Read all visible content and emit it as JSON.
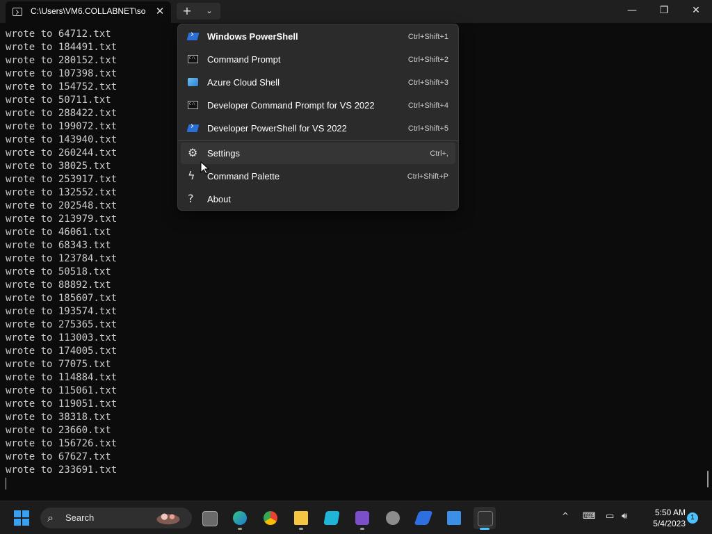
{
  "titlebar": {
    "tab_title": "C:\\Users\\VM6.COLLABNET\\so",
    "tab_close": "✕",
    "new_tab": "+",
    "dropdown": "⌄",
    "minimize": "—",
    "maximize": "❐",
    "close": "✕"
  },
  "terminal": {
    "lines": [
      "wrote to 64712.txt",
      "wrote to 184491.txt",
      "wrote to 280152.txt",
      "wrote to 107398.txt",
      "wrote to 154752.txt",
      "wrote to 50711.txt",
      "wrote to 288422.txt",
      "wrote to 199072.txt",
      "wrote to 143940.txt",
      "wrote to 260244.txt",
      "wrote to 38025.txt",
      "wrote to 253917.txt",
      "wrote to 132552.txt",
      "wrote to 202548.txt",
      "wrote to 213979.txt",
      "wrote to 46061.txt",
      "wrote to 68343.txt",
      "wrote to 123784.txt",
      "wrote to 50518.txt",
      "wrote to 88892.txt",
      "wrote to 185607.txt",
      "wrote to 193574.txt",
      "wrote to 275365.txt",
      "wrote to 113003.txt",
      "wrote to 174005.txt",
      "wrote to 77075.txt",
      "wrote to 114884.txt",
      "wrote to 115061.txt",
      "wrote to 119051.txt",
      "wrote to 38318.txt",
      "wrote to 23660.txt",
      "wrote to 156726.txt",
      "wrote to 67627.txt",
      "wrote to 233691.txt"
    ]
  },
  "menu": {
    "items": [
      {
        "label": "Windows PowerShell",
        "shortcut": "Ctrl+Shift+1",
        "icon": "powershell-icon"
      },
      {
        "label": "Command Prompt",
        "shortcut": "Ctrl+Shift+2",
        "icon": "cmd-icon"
      },
      {
        "label": "Azure Cloud Shell",
        "shortcut": "Ctrl+Shift+3",
        "icon": "azure-icon"
      },
      {
        "label": "Developer Command Prompt for VS 2022",
        "shortcut": "Ctrl+Shift+4",
        "icon": "cmd-icon"
      },
      {
        "label": "Developer PowerShell for VS 2022",
        "shortcut": "Ctrl+Shift+5",
        "icon": "powershell-icon"
      }
    ],
    "actions": [
      {
        "label": "Settings",
        "shortcut": "Ctrl+,",
        "icon": "gear-icon",
        "glyph": "⚙"
      },
      {
        "label": "Command Palette",
        "shortcut": "Ctrl+Shift+P",
        "icon": "lightning-icon",
        "glyph": "ϟ"
      },
      {
        "label": "About",
        "shortcut": "",
        "icon": "question-icon",
        "glyph": "?"
      }
    ]
  },
  "taskbar": {
    "search_label": "Search",
    "search_glyph": "⌕",
    "tray_chevron": "^",
    "time": "5:50 AM",
    "date": "5/4/2023",
    "notification_count": "1",
    "colors": {
      "accent": "#4cc2ff",
      "start": "#3aa0f0"
    }
  }
}
